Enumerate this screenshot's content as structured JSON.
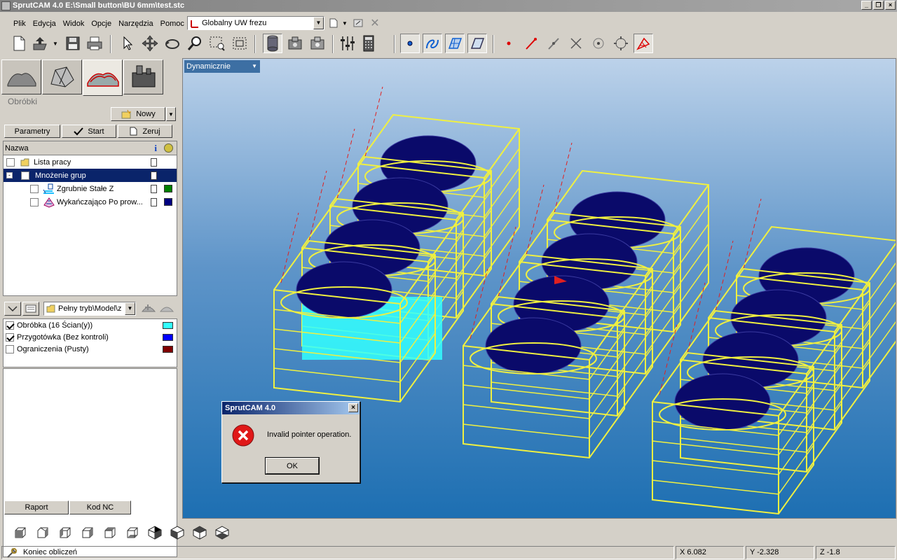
{
  "window": {
    "title": "SprutCAM 4.0 E:\\Small button\\BU 6mm\\test.stc",
    "minimize": "_",
    "maximize": "❐",
    "close": "×"
  },
  "menu": {
    "items": [
      "Plik",
      "Edycja",
      "Widok",
      "Opcje",
      "Narzędzia",
      "Pomoc"
    ]
  },
  "coord_system": {
    "value": "Globalny UW frezu"
  },
  "left_panel": {
    "section_title": "Obróbki",
    "new_button": "Nowy",
    "actions": {
      "params": "Parametry",
      "start": "Start",
      "reset": "Zeruj"
    },
    "tree": {
      "header": "Nazwa",
      "rows": [
        {
          "label": "Lista pracy",
          "checked": false,
          "selected": false
        },
        {
          "label": "Mnożenie grup",
          "checked": false,
          "selected": true
        },
        {
          "label": "Zgrubnie Stałe Z",
          "checked": false,
          "selected": false,
          "color": "#008000"
        },
        {
          "label": "Wykańczająco Po prow...",
          "checked": false,
          "selected": false,
          "color": "#000080"
        }
      ]
    },
    "mode_combo": "Pełny tryb\\Model\\z",
    "layers": [
      {
        "label": "Obróbka  (16 Ścian(y))",
        "checked": true,
        "color": "#33ffff"
      },
      {
        "label": "Przygotówka  (Bez kontroli)",
        "checked": true,
        "color": "#0000ff"
      },
      {
        "label": "Ograniczenia  (Pusty)",
        "checked": false,
        "color": "#800000"
      }
    ],
    "bottom_buttons": {
      "report": "Raport",
      "nc_code": "Kod NC"
    }
  },
  "viewport": {
    "view_mode": "Dynamicznie",
    "wire_color": "#f0f040",
    "solid_color": "#0a0a6a",
    "highlight_color": "#33ffff"
  },
  "dialog": {
    "title": "SprutCAM 4.0",
    "message": "Invalid pointer operation.",
    "ok": "OK",
    "icon": "error-icon"
  },
  "status": {
    "message": "Koniec obliczeń",
    "x": "X 6.082",
    "y": "Y -2.328",
    "z": "Z -1.8"
  }
}
